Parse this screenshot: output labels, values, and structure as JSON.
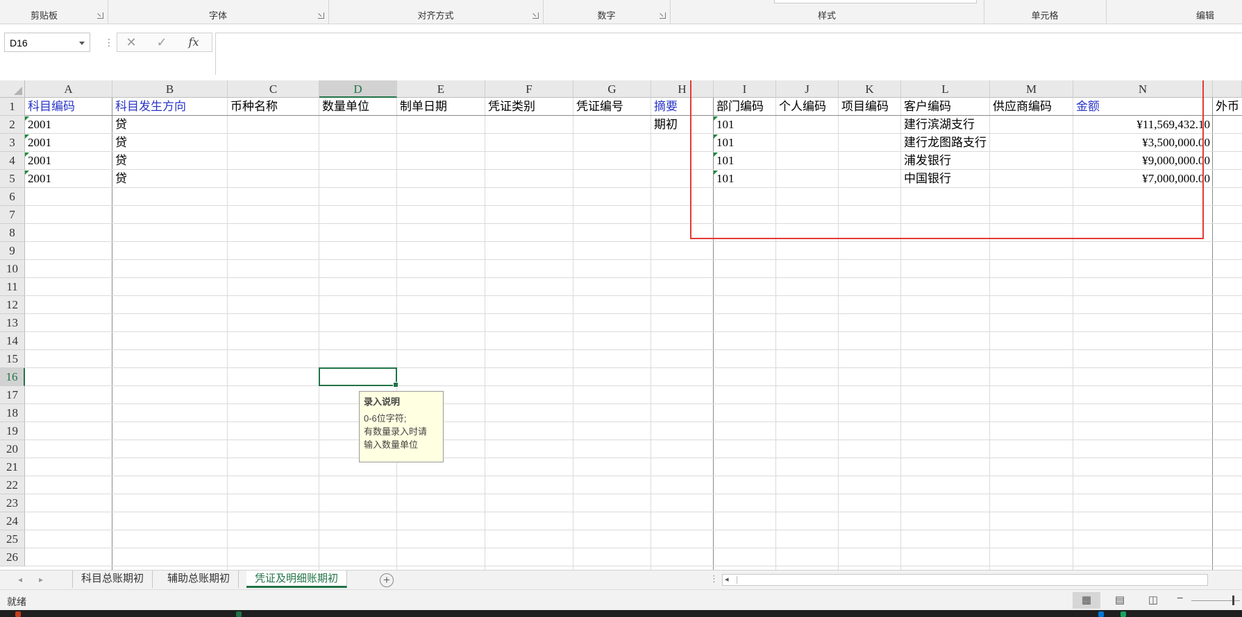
{
  "ribbon": {
    "groups": [
      {
        "label": "剪贴板"
      },
      {
        "label": "字体"
      },
      {
        "label": "对齐方式"
      },
      {
        "label": "数字"
      },
      {
        "label": "样式"
      },
      {
        "label": "单元格"
      },
      {
        "label": "编辑"
      }
    ]
  },
  "formula_bar": {
    "name_box": "D16",
    "cancel_icon": "✕",
    "enter_icon": "✓",
    "fx_label": "fx",
    "formula": ""
  },
  "grid": {
    "columns": [
      "A",
      "B",
      "C",
      "D",
      "E",
      "F",
      "G",
      "H",
      "I",
      "J",
      "K",
      "L",
      "M",
      "N"
    ],
    "selected_column": "D",
    "rows": [
      "1",
      "2",
      "3",
      "4",
      "5",
      "6",
      "7",
      "8",
      "9",
      "10",
      "11",
      "12",
      "13",
      "14",
      "15",
      "16",
      "17",
      "18",
      "19",
      "20",
      "21",
      "22",
      "23",
      "24",
      "25",
      "26"
    ],
    "selected_row": "16",
    "headers": {
      "A": "科目编码",
      "B": "科目发生方向",
      "C": "币种名称",
      "D": "数量单位",
      "E": "制单日期",
      "F": "凭证类别",
      "G": "凭证编号",
      "H": "摘要",
      "I": "部门编码",
      "J": "个人编码",
      "K": "项目编码",
      "L": "客户编码",
      "M": "供应商编码",
      "N": "金额",
      "O": "外币"
    },
    "data_rows": [
      {
        "A": "2001",
        "B": "贷",
        "H": "期初",
        "I": "101",
        "L": "建行滨湖支行",
        "N": "¥11,569,432.10"
      },
      {
        "A": "2001",
        "B": "贷",
        "H": "",
        "I": "101",
        "L": "建行龙图路支行",
        "N": "¥3,500,000.00"
      },
      {
        "A": "2001",
        "B": "贷",
        "H": "",
        "I": "101",
        "L": "浦发银行",
        "N": "¥9,000,000.00"
      },
      {
        "A": "2001",
        "B": "贷",
        "H": "",
        "I": "101",
        "L": "中国银行",
        "N": "¥7,000,000.00"
      }
    ],
    "header_colors": {
      "blue": "#2a35c8",
      "black": "#000000"
    },
    "tooltip": {
      "title": "录入说明",
      "lines": [
        "0-6位字符;",
        "有数量录入时请",
        "输入数量单位"
      ]
    }
  },
  "sheet_tabs": {
    "tabs": [
      {
        "label": "科目总账期初"
      },
      {
        "label": "辅助总账期初"
      },
      {
        "label": "凭证及明细账期初"
      }
    ],
    "active_tab": "凭证及明细账期初"
  },
  "status_bar": {
    "status": "就绪"
  },
  "colors": {
    "accent": "#217346",
    "highlight_box": "#e53935",
    "tooltip_bg": "#ffffe1"
  }
}
